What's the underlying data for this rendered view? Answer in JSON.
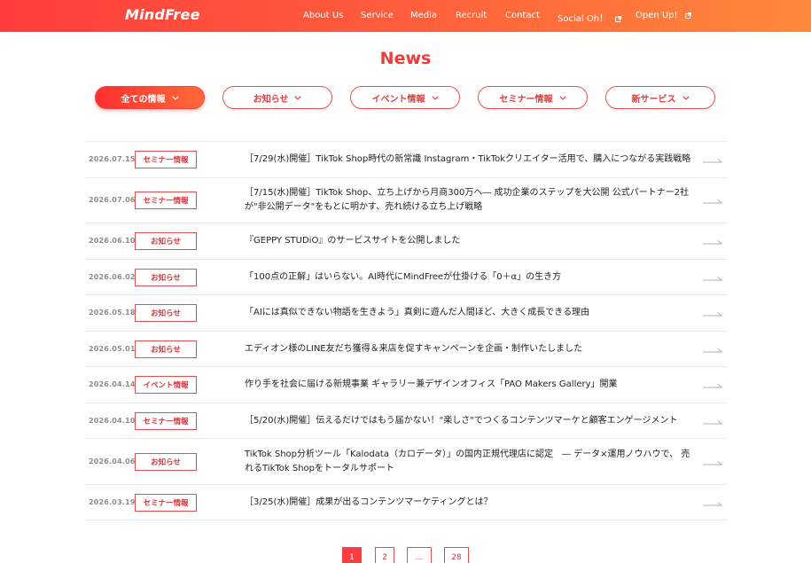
{
  "header": {
    "logo": "MindFree",
    "nav": [
      {
        "label": "About Us",
        "external": false
      },
      {
        "label": "Service",
        "external": false
      },
      {
        "label": "Media",
        "external": false
      },
      {
        "label": "Recruit",
        "external": false
      },
      {
        "label": "Contact",
        "external": false
      },
      {
        "label": "Social Oh！",
        "external": true
      },
      {
        "label": "Open Up!",
        "external": true
      }
    ]
  },
  "page_title": "News",
  "filters": [
    {
      "label": "全ての情報",
      "active": true
    },
    {
      "label": "お知らせ",
      "active": false
    },
    {
      "label": "イベント情報",
      "active": false
    },
    {
      "label": "セミナー情報",
      "active": false
    },
    {
      "label": "新サービス",
      "active": false
    }
  ],
  "news": [
    {
      "date": "2026.07.15",
      "tag": "セミナー情報",
      "title": "［7/29(水)開催］TikTok Shop時代の新常識 Instagram・TikTokクリエイター活用で、購入につながる実践戦略"
    },
    {
      "date": "2026.07.06",
      "tag": "セミナー情報",
      "title": "［7/15(水)開催］TikTok Shop、立ち上げから月商300万へ― 成功企業のステップを大公開 公式パートナー2社が\"非公開データ\"をもとに明かす、売れ続ける立ち上げ戦略"
    },
    {
      "date": "2026.06.10",
      "tag": "お知らせ",
      "title": "『GEPPY STUDiO』のサービスサイトを公開しました"
    },
    {
      "date": "2026.06.02",
      "tag": "お知らせ",
      "title": "「100点の正解」はいらない。AI時代にMindFreeが仕掛ける「0＋α」の生き方"
    },
    {
      "date": "2026.05.18",
      "tag": "お知らせ",
      "title": "「AIには真似できない物語を生きよう」真剣に遊んだ人間ほど、大きく成長できる理由"
    },
    {
      "date": "2026.05.01",
      "tag": "お知らせ",
      "title": "エディオン様のLINE友だち獲得＆来店を促すキャンペーンを企画・制作いたしました"
    },
    {
      "date": "2026.04.14",
      "tag": "イベント情報",
      "title": "作り手を社会に届ける新規事業 ギャラリー兼デザインオフィス「PAO Makers Gallery」開業"
    },
    {
      "date": "2026.04.10",
      "tag": "セミナー情報",
      "title": "［5/20(水)開催］伝えるだけではもう届かない！\"楽しさ\"でつくるコンテンツマーケと顧客エンゲージメント"
    },
    {
      "date": "2026.04.06",
      "tag": "お知らせ",
      "title": "TikTok Shop分析ツール「Kalodata（カロデータ）」の国内正規代理店に認定　― データ×運用ノウハウで、 売れるTikTok Shopをトータルサポート"
    },
    {
      "date": "2026.03.19",
      "tag": "セミナー情報",
      "title": "［3/25(水)開催］成果が出るコンテンツマーケティングとは？"
    }
  ],
  "pagination": {
    "pages": [
      "1",
      "2",
      "…",
      "28"
    ],
    "current": "1"
  },
  "colors": {
    "accent": "#ef3b3b",
    "header_gradient_start": "#ff3d3d",
    "header_gradient_end": "#ff8a3a"
  }
}
